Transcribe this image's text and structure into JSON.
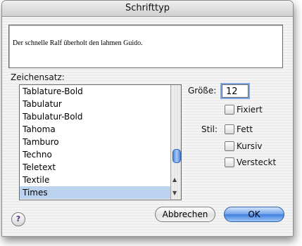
{
  "window": {
    "title": "Schrifttyp"
  },
  "preview": {
    "text": "Der schnelle Ralf überholt den lahmen Guido."
  },
  "charset": {
    "label": "Zeichensatz:",
    "items": [
      {
        "label": "Tablature-Bold",
        "selected": false
      },
      {
        "label": "Tabulatur",
        "selected": false
      },
      {
        "label": "Tabulatur-Bold",
        "selected": false
      },
      {
        "label": "Tahoma",
        "selected": false
      },
      {
        "label": "Tamburo",
        "selected": false
      },
      {
        "label": "Techno",
        "selected": false
      },
      {
        "label": "Teletext",
        "selected": false
      },
      {
        "label": "Textile",
        "selected": false
      },
      {
        "label": "Times",
        "selected": true
      }
    ],
    "scroll_up_glyph": "▲",
    "scroll_down_glyph": "▼"
  },
  "size": {
    "label": "Größe:",
    "value": "12",
    "fixed_label": "Fixiert",
    "fixed_checked": false
  },
  "style": {
    "label": "Stil:",
    "options": [
      {
        "label": "Fett",
        "checked": false
      },
      {
        "label": "Kursiv",
        "checked": false
      },
      {
        "label": "Versteckt",
        "checked": false
      }
    ]
  },
  "buttons": {
    "cancel": "Abbrechen",
    "ok": "OK",
    "help": "?"
  },
  "colors": {
    "selection": "#bcd3ef",
    "ok_button": "#3e7fe0",
    "focus_ring": "#7fa7e6"
  }
}
